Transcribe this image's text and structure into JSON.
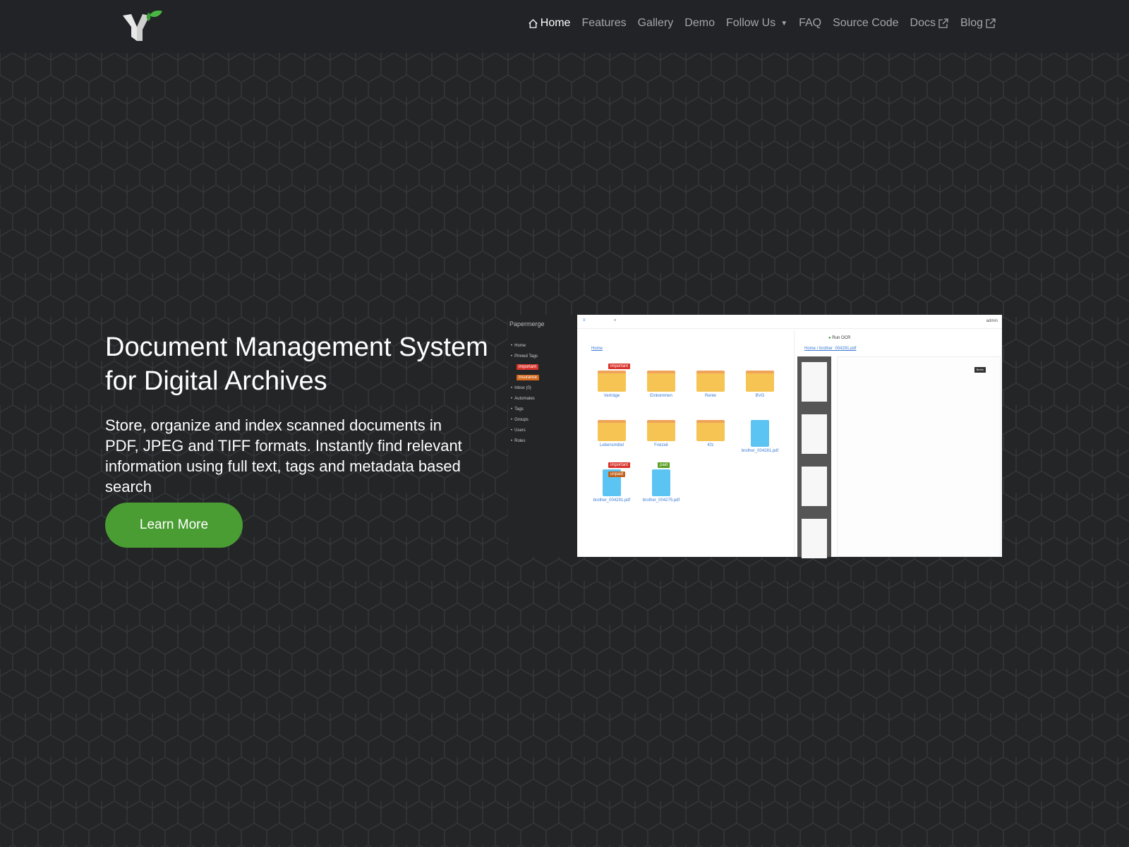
{
  "nav": {
    "items": [
      {
        "label": "Home",
        "icon": "home-icon",
        "active": true
      },
      {
        "label": "Features"
      },
      {
        "label": "Gallery"
      },
      {
        "label": "Demo"
      },
      {
        "label": "Follow Us",
        "icon": "caret-down-icon"
      },
      {
        "label": "FAQ"
      },
      {
        "label": "Source Code"
      },
      {
        "label": "Docs",
        "icon": "external-link-icon"
      },
      {
        "label": "Blog",
        "icon": "external-link-icon"
      }
    ]
  },
  "hero": {
    "title": "Document Management System for Digital Archives",
    "text": "Store, organize and index scanned documents in PDF, JPEG and TIFF formats. Instantly find relevant information using full text, tags and metadata based search",
    "button": "Learn More"
  },
  "screenshot": {
    "brand": "Papermerge",
    "sidebar": [
      "Home",
      "Pinned Tags",
      "Inbox (0)",
      "Automates",
      "Tags",
      "Groups",
      "Users",
      "Roles"
    ],
    "pinned_tags": [
      {
        "label": "important",
        "color": "#d9342b"
      },
      {
        "label": "insurance",
        "color": "#d2691e"
      }
    ],
    "user": "admin",
    "crumb": "Home",
    "items": [
      {
        "label": "Verträge",
        "type": "folder",
        "tags": [
          "important"
        ]
      },
      {
        "label": "Einkommen",
        "type": "folder"
      },
      {
        "label": "Rente",
        "type": "folder"
      },
      {
        "label": "BVG",
        "type": "folder"
      },
      {
        "label": "Lebensmittel",
        "type": "folder"
      },
      {
        "label": "Freizeit",
        "type": "folder"
      },
      {
        "label": "Kfz",
        "type": "folder"
      },
      {
        "label": "brother_004281.pdf",
        "type": "doc"
      },
      {
        "label": "brother_004291.pdf",
        "type": "doc",
        "tags": [
          "important",
          "unpaid"
        ]
      },
      {
        "label": "brother_004275.pdf",
        "type": "doc",
        "tags": [
          "paid"
        ]
      }
    ],
    "viewer": {
      "run_ocr": "Run OCR",
      "crumb_home": "Home",
      "crumb_doc": "brother_004291.pdf",
      "stamp": "Berlin"
    }
  },
  "colors": {
    "accent": "#4a9d33",
    "bg": "#232527",
    "nav_bg": "#212326"
  }
}
